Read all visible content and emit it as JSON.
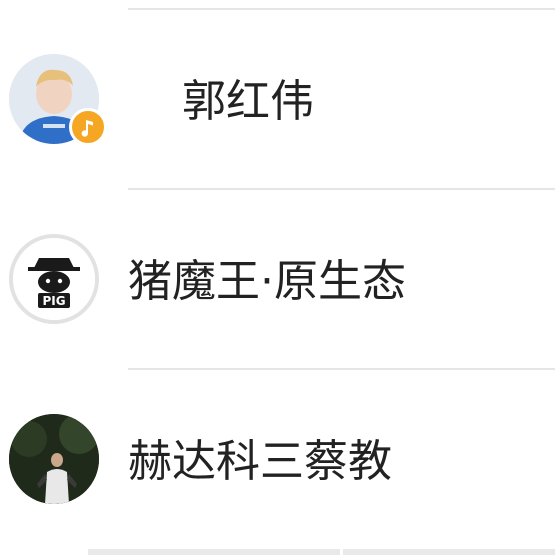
{
  "contacts": [
    {
      "name": "郭红伟",
      "avatar_icon": "person-blue-shirt-avatar",
      "badge_icon": "music-note-icon",
      "badge_color": "#f5a623"
    },
    {
      "name": "猪魔王·原生态",
      "avatar_icon": "pig-logo-avatar",
      "avatar_text": "PIG"
    },
    {
      "name": "赫达科三蔡教",
      "avatar_icon": "person-dark-outdoor-avatar"
    }
  ],
  "colors": {
    "divider": "#e6e6e6",
    "text": "#222222",
    "badge": "#f5a623"
  }
}
